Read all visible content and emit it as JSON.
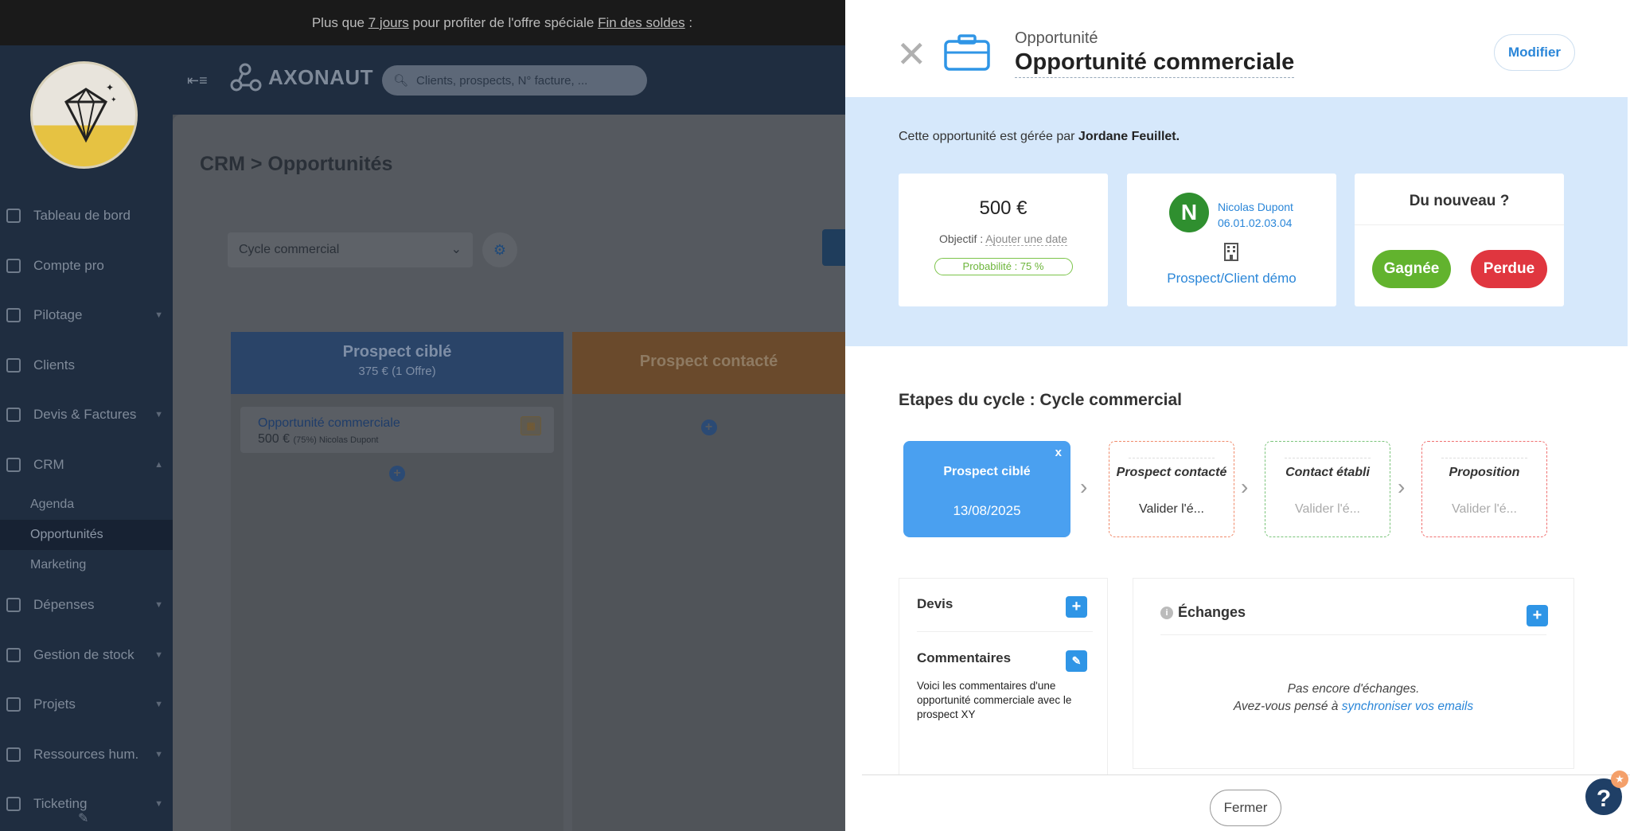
{
  "promo": {
    "pre": "Plus que ",
    "days": "7 jours",
    "mid": " pour profiter de l'offre spéciale ",
    "sale": "Fin des soldes",
    "post": " :"
  },
  "brand": {
    "name": "AXONAUT"
  },
  "search": {
    "placeholder": "Clients, prospects, N° facture, ..."
  },
  "sidebar": {
    "items": [
      {
        "label": "Tableau de bord",
        "chevron": false
      },
      {
        "label": "Compte pro",
        "chevron": false
      },
      {
        "label": "Pilotage",
        "chevron": true
      },
      {
        "label": "Clients",
        "chevron": false
      },
      {
        "label": "Devis & Factures",
        "chevron": true
      },
      {
        "label": "CRM",
        "chevron": true
      }
    ],
    "sub_items": [
      "Agenda",
      "Opportunités",
      "Marketing"
    ],
    "items_after": [
      {
        "label": "Dépenses"
      },
      {
        "label": "Gestion de stock"
      },
      {
        "label": "Projets"
      },
      {
        "label": "Ressources hum."
      },
      {
        "label": "Ticketing"
      }
    ]
  },
  "main": {
    "title": "CRM > Opportunités",
    "cycle_select": "Cycle commercial",
    "columns": [
      {
        "title": "Prospect ciblé",
        "subtitle": "375 € (1 Offre)"
      },
      {
        "title": "Prospect contacté",
        "subtitle": ""
      }
    ],
    "card": {
      "title": "Opportunité commerciale",
      "amount": "500 €",
      "meta": "(75%) Nicolas Dupont"
    }
  },
  "panel": {
    "kicker": "Opportunité",
    "title": "Opportunité commerciale",
    "edit_label": "Modifier",
    "managed_prefix": "Cette opportunité est gérée par ",
    "managed_by": "Jordane Feuillet.",
    "amount": "500 €",
    "objective_label": "Objectif : ",
    "objective_value": "Ajouter une date",
    "probability": "Probabilité : 75 %",
    "contact": {
      "initial": "N",
      "name": "Nicolas Dupont",
      "phone": "06.01.02.03.04",
      "company": "Prospect/Client démo"
    },
    "news": {
      "question": "Du nouveau ?",
      "won": "Gagnée",
      "lost": "Perdue"
    },
    "steps_title": "Etapes du cycle : Cycle commercial",
    "steps": [
      {
        "name": "Prospect ciblé",
        "detail": "13/08/2025",
        "remove": "x"
      },
      {
        "name": "Prospect contacté",
        "detail": "Valider l'é..."
      },
      {
        "name": "Contact établi",
        "detail": "Valider l'é..."
      },
      {
        "name": "Proposition",
        "detail": "Valider l'é..."
      }
    ],
    "quotes_label": "Devis",
    "comments_label": "Commentaires",
    "comments_text": "Voici les commentaires d'une opportunité commerciale avec le prospect XY",
    "exchanges_label": "Échanges",
    "exchanges_empty": "Pas encore d'échanges.",
    "exchanges_hint": "Avez-vous pensé à ",
    "exchanges_link": "synchroniser vos emails",
    "close_label": "Fermer"
  },
  "colors": {
    "accent": "#2a86d8",
    "won": "#62b32e",
    "lost": "#e0363f",
    "step_active": "#4aa0f0"
  }
}
